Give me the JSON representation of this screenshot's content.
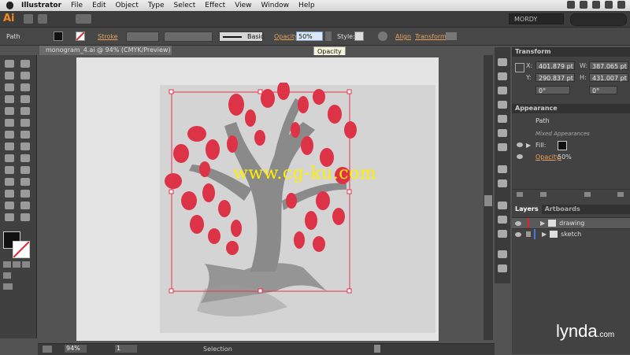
{
  "menubar": {
    "app": "Illustrator",
    "items": [
      "File",
      "Edit",
      "Object",
      "Type",
      "Select",
      "Effect",
      "View",
      "Window",
      "Help"
    ]
  },
  "appbar": {
    "logo": "Ai",
    "workspace": "MORDY"
  },
  "controlbar": {
    "object_type": "Path",
    "stroke_label": "Stroke",
    "brush": "Basic",
    "opacity_label": "Opacity",
    "opacity_value": "50%",
    "style_label": "Style:",
    "align_label": "Align",
    "transform_label": "Transform",
    "tooltip": "Opacity"
  },
  "document": {
    "tab": "monogram_4.ai @ 94% (CMYK/Preview)"
  },
  "transform": {
    "title": "Transform",
    "x_label": "X:",
    "x_value": "401.879 pt",
    "y_label": "Y:",
    "y_value": "290.837 pt",
    "w_label": "W:",
    "w_value": "387.065 pt",
    "h_label": "H:",
    "h_value": "431.007 pt",
    "rot": "0°",
    "shear": "0°"
  },
  "appearance": {
    "title": "Appearance",
    "object": "Path",
    "mixed": "Mixed Appearances",
    "fill_label": "Fill:",
    "opacity_label": "Opacity:",
    "opacity_value": "50%"
  },
  "layers": {
    "tabs": [
      "Layers",
      "Artboards"
    ],
    "rows": [
      "drawing",
      "sketch"
    ]
  },
  "status": {
    "zoom": "94%",
    "page": "1",
    "tool": "Selection"
  },
  "watermark": "www.cg-ku.com",
  "brand": {
    "name": "lynda",
    "suffix": ".com"
  },
  "colors": {
    "accent": "#f48a1e",
    "selection": "#e8324a",
    "tree_fill": "#dd3347",
    "trunk": "#8a8a8a"
  }
}
